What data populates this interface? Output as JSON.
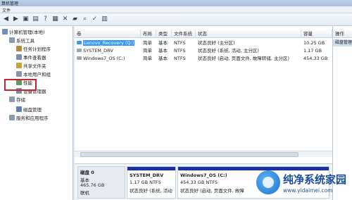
{
  "window": {
    "title": "算机管理"
  },
  "menubar": {
    "file_label": "文件"
  },
  "toolbar": {
    "buttons": [
      {
        "icon": "back-arrow-icon",
        "glyph": "◀"
      },
      {
        "icon": "forward-arrow-icon",
        "glyph": "▶"
      },
      {
        "icon": "up-folder-icon",
        "glyph": "▣"
      },
      {
        "icon": "properties-icon",
        "glyph": "▤"
      },
      {
        "icon": "help-icon",
        "glyph": "?"
      },
      {
        "icon": "console-icon",
        "glyph": "▦"
      },
      {
        "icon": "delete-icon",
        "glyph": "✕"
      },
      {
        "icon": "open-folder-icon",
        "glyph": "▰"
      },
      {
        "icon": "search-icon",
        "glyph": "⌕"
      },
      {
        "icon": "disk-check-icon",
        "glyph": "✓"
      },
      {
        "icon": "view-icon",
        "glyph": "▥"
      }
    ]
  },
  "tree": {
    "items": [
      {
        "label": "计算机管理(本地)",
        "icon": "computer-management-icon",
        "indent": 0
      },
      {
        "label": "系统工具",
        "icon": "system-tools-icon",
        "indent": 1
      },
      {
        "label": "任务计划程序",
        "icon": "task-scheduler-icon",
        "indent": 2
      },
      {
        "label": "事件查看器",
        "icon": "event-viewer-icon",
        "indent": 2
      },
      {
        "label": "共享文件夹",
        "icon": "shared-folders-icon",
        "indent": 2
      },
      {
        "label": "本地用户和组",
        "icon": "users-groups-icon",
        "indent": 2
      },
      {
        "label": "性能",
        "icon": "performance-icon",
        "indent": 2
      },
      {
        "label": "设备管理器",
        "icon": "device-manager-icon",
        "indent": 2
      },
      {
        "label": "存储",
        "icon": "storage-icon",
        "indent": 1
      },
      {
        "label": "磁盘管理",
        "icon": "disk-management-icon",
        "indent": 2
      },
      {
        "label": "服务和应用程序",
        "icon": "services-icon",
        "indent": 1
      }
    ],
    "selected": "磁盘管理"
  },
  "volume_table": {
    "columns": [
      "卷",
      "布局",
      "类型",
      "文件系统",
      "状态",
      "容量"
    ],
    "rows": [
      [
        "Lenovo_Recovery (Q:)",
        "简单",
        "基本",
        "NTFS",
        "状态良好 (主分区)",
        "10.25 GB"
      ],
      [
        "SYSTEM_DRV",
        "简单",
        "基本",
        "NTFS",
        "状态良好 (系统, 活动, 主分区)",
        "1.17 GB"
      ],
      [
        "Windows7_OS (C:)",
        "简单",
        "基本",
        "NTFS",
        "状态良好 (启动, 页面文件, 故障转储, 主分区)",
        "454.33 GB"
      ]
    ],
    "selected_row": 0
  },
  "disk": {
    "name": "磁盘 0",
    "type": "基本",
    "size": "465.76 GB",
    "status": "联机",
    "partitions": [
      {
        "name": "SYSTEM_DRV",
        "size": "1.17 GB NTFS",
        "status": "状态良好 (系统, 活动"
      },
      {
        "name": "Windows7_OS  (C:)",
        "size": "454.33 GB NTFS",
        "status": "状态良好 (启动, 页面文件, 故障"
      }
    ]
  },
  "actions": {
    "header": "操作",
    "item": "磁盘管理"
  },
  "watermark": {
    "title": "纯净系统家园",
    "url": "www.yidaimei.com"
  },
  "colors": {
    "selection": "#3399ff",
    "partition_bar": "#1a2fa5",
    "highlight_box": "#c9232b"
  }
}
